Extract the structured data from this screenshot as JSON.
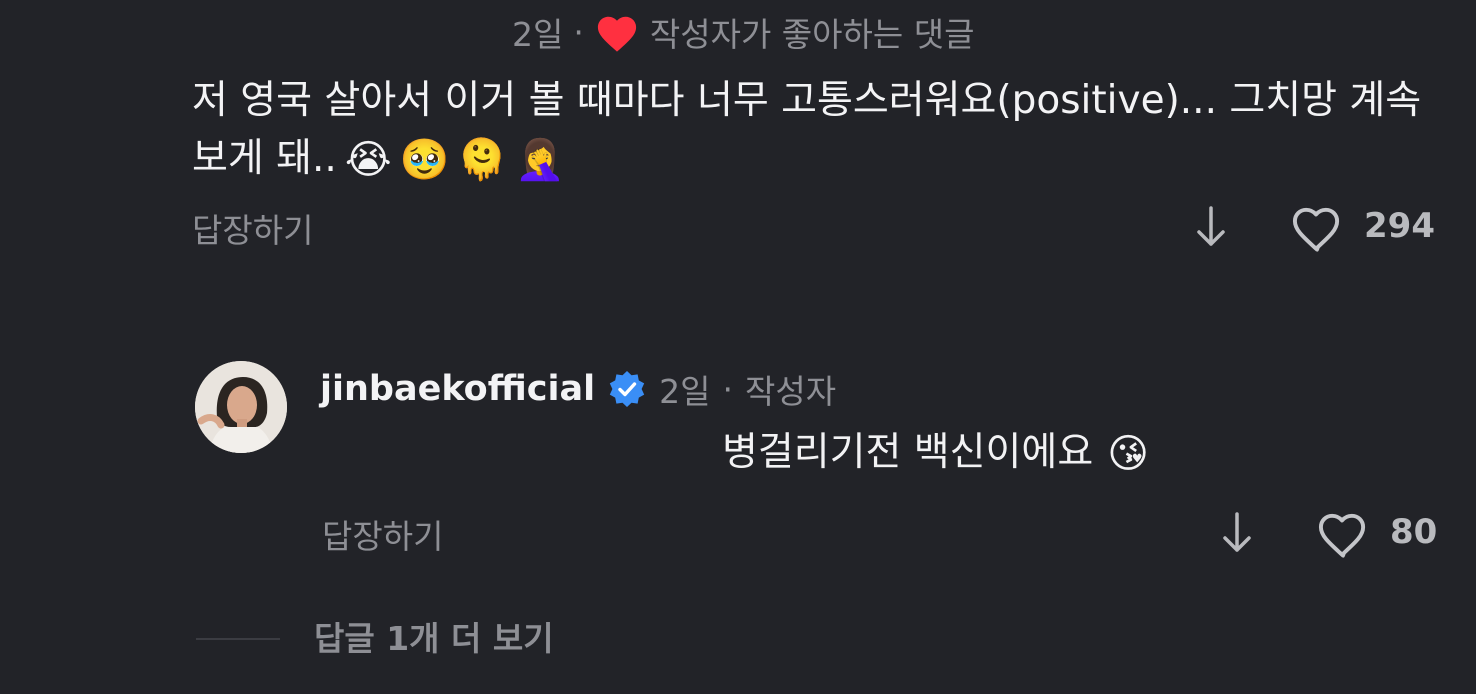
{
  "comment": {
    "time": "2일",
    "dot": "·",
    "liked_by_author": "작성자가 좋아하는 댓글",
    "text": "저 영국 살아서 이거 볼 때마다 너무 고통스러워요(positive)... 그치망 계속 보게 돼..",
    "emojis": [
      "😭",
      "🥹",
      "🫠",
      "🤦‍♀️"
    ],
    "reply_label": "답장하기",
    "like_count": "294",
    "colors": {
      "heart": "#ff3040"
    },
    "icons": [
      "heart-icon",
      "downvote-arrow-icon",
      "like-heart-outline-icon"
    ]
  },
  "reply": {
    "username": "jinbaekofficial",
    "time": "2일",
    "dot": "·",
    "author_tag": "작성자",
    "text": "병걸리기전 백신이에요",
    "emoji": "😘",
    "reply_label": "답장하기",
    "like_count": "80",
    "colors": {
      "verified": "#3a8ef6"
    },
    "icons": [
      "verified-badge-icon",
      "downvote-arrow-icon",
      "like-heart-outline-icon"
    ]
  },
  "more_replies": "답글 1개 더 보기"
}
